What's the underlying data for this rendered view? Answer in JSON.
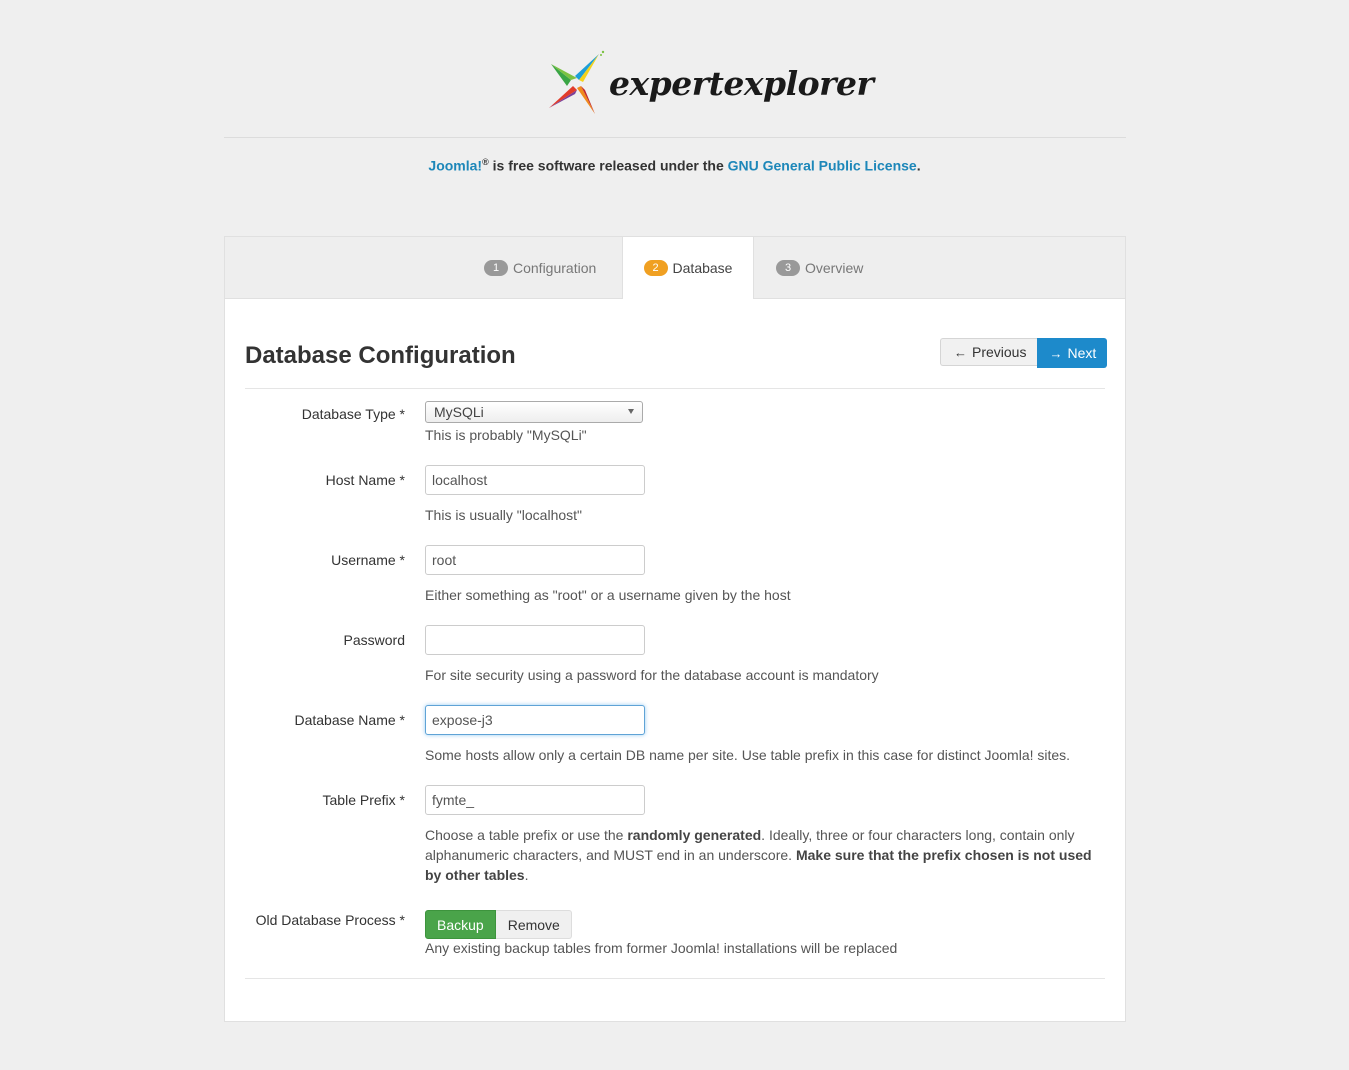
{
  "brand": {
    "logo_text": "expertexplorer"
  },
  "license": {
    "joomla_link": "Joomla!",
    "registered": "®",
    "middle": " is free software released under the ",
    "gpl_link": "GNU General Public License",
    "end": "."
  },
  "tabs": [
    {
      "num": "1",
      "label": "Configuration",
      "active": false
    },
    {
      "num": "2",
      "label": "Database",
      "active": true
    },
    {
      "num": "3",
      "label": "Overview",
      "active": false
    }
  ],
  "page": {
    "title": "Database Configuration",
    "previous_label": "Previous",
    "next_label": "Next"
  },
  "fields": {
    "db_type": {
      "label": "Database Type *",
      "value": "MySQLi",
      "help": "This is probably \"MySQLi\""
    },
    "host": {
      "label": "Host Name *",
      "value": "localhost",
      "help": "This is usually \"localhost\""
    },
    "username": {
      "label": "Username *",
      "value": "root",
      "help": "Either something as \"root\" or a username given by the host"
    },
    "password": {
      "label": "Password",
      "value": "",
      "help": "For site security using a password for the database account is mandatory"
    },
    "db_name": {
      "label": "Database Name *",
      "value": "expose-j3",
      "help": "Some hosts allow only a certain DB name per site. Use table prefix in this case for distinct Joomla! sites."
    },
    "prefix": {
      "label": "Table Prefix *",
      "value": "fymte_",
      "help_1": "Choose a table prefix or use the ",
      "help_bold_1": "randomly generated",
      "help_2": ". Ideally, three or four characters long, contain only alphanumeric characters, and MUST end in an underscore. ",
      "help_bold_2": "Make sure that the prefix chosen is not used by other tables",
      "help_3": "."
    },
    "old_db": {
      "label": "Old Database Process *",
      "backup_label": "Backup",
      "remove_label": "Remove",
      "help": "Any existing backup tables from former Joomla! installations will be replaced"
    }
  },
  "colors": {
    "accent_blue": "#1d8acb",
    "link_blue": "#1d87b9",
    "active_step": "#f0a022",
    "success_green": "#4aa44a"
  }
}
